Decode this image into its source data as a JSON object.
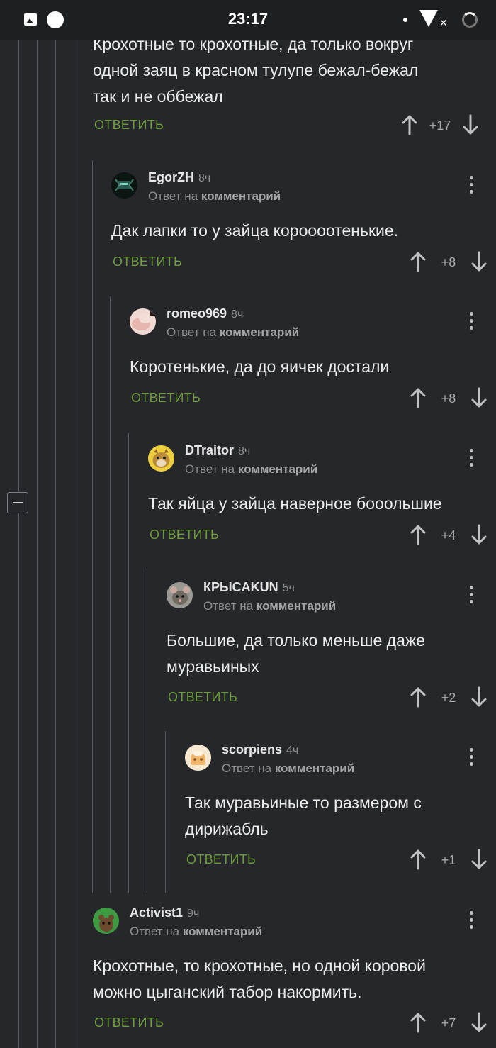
{
  "status": {
    "time": "23:17"
  },
  "ui": {
    "reply_label": "ОТВЕТИТЬ",
    "reply_to_prefix": "Ответ на",
    "reply_to_target": "комментарий"
  },
  "top_comment": {
    "lines": [
      "Крохотные то крохотные, да только вокруг",
      "одной заяц в красном тулупе бежал-бежал",
      "так и не оббежал"
    ],
    "score": "+17"
  },
  "comments": [
    {
      "author": "EgorZH",
      "time": "8ч",
      "lines": [
        "Дак лапки то у зайца короооотенькие."
      ],
      "score": "+8"
    },
    {
      "author": "romeo969",
      "time": "8ч",
      "lines": [
        "Коротенькие, да до яичек достали"
      ],
      "score": "+8"
    },
    {
      "author": "DTraitor",
      "time": "8ч",
      "lines": [
        "Так яйца у зайца наверное бооольшие"
      ],
      "score": "+4"
    },
    {
      "author": "КРЫСAKUN",
      "time": "5ч",
      "lines": [
        "Большие, да только меньше даже",
        "муравьиных"
      ],
      "score": "+2"
    },
    {
      "author": "scorpiens",
      "time": "4ч",
      "lines": [
        "Так муравьиные то размером с",
        "дирижабль"
      ],
      "score": "+1"
    },
    {
      "author": "Activist1",
      "time": "9ч",
      "lines": [
        "Крохотные, то крохотные, но одной коровой",
        "можно цыганский табор накормить."
      ],
      "score": "+7"
    }
  ],
  "colors": {
    "background": "#25272a",
    "reply_green": "#6d9c3c",
    "muted_text": "#8d9093"
  }
}
